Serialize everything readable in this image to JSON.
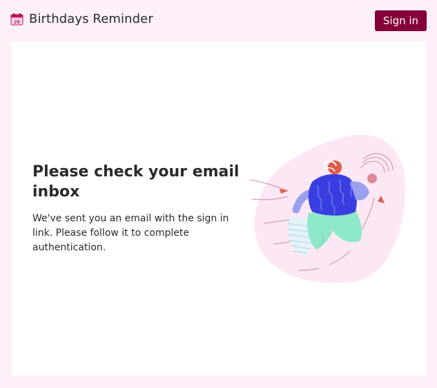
{
  "app": {
    "title": "Birthdays Reminder",
    "calendar_day": "26",
    "icon": "calendar-icon"
  },
  "header": {
    "signin_label": "Sign in"
  },
  "main": {
    "heading": "Please check your email inbox",
    "message": "We've sent you an email with the sign in link. Please follow it to complete authentication.",
    "illustration": "running-person-illustration"
  },
  "colors": {
    "page_background": "#fdf0f8",
    "accent": "#850039",
    "card": "#ffffff",
    "text": "#2a2a2e",
    "illustration_blob": "#fce8f4",
    "shirt": "#3a3ee0",
    "pants": "#8ee8c8"
  }
}
